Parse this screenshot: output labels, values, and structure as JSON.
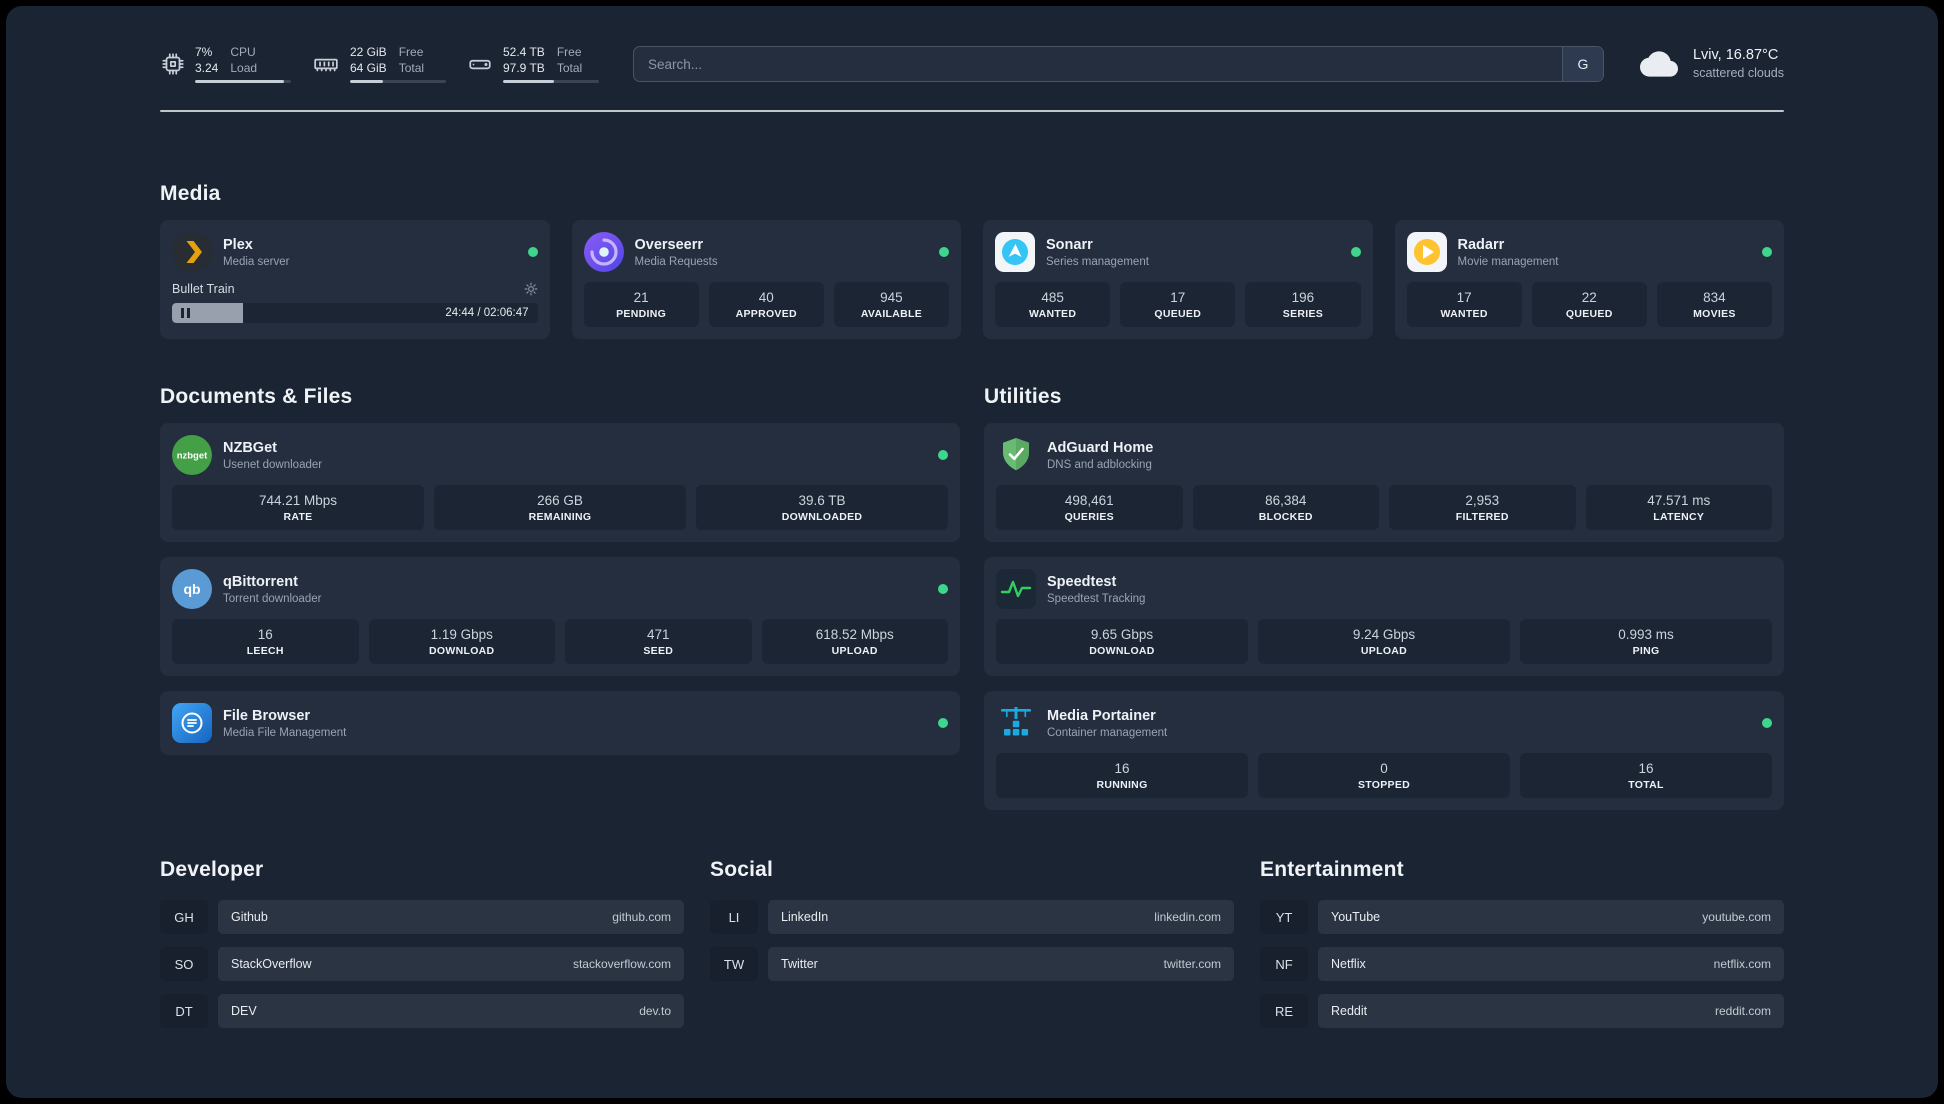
{
  "topbar": {
    "cpu": {
      "value1": "7%",
      "value2": "3.24",
      "label1": "CPU",
      "label2": "Load",
      "bar_percent": 93
    },
    "ram": {
      "value1": "22 GiB",
      "value2": "64 GiB",
      "label1": "Free",
      "label2": "Total",
      "bar_percent": 34
    },
    "disk": {
      "value1": "52.4 TB",
      "value2": "97.9 TB",
      "label1": "Free",
      "label2": "Total",
      "bar_percent": 53
    },
    "search": {
      "placeholder": "Search...",
      "button_label": "G"
    },
    "weather": {
      "location": "Lviv, 16.87°C",
      "condition": "scattered clouds"
    }
  },
  "media": {
    "title": "Media",
    "plex": {
      "name": "Plex",
      "desc": "Media server",
      "now_playing": "Bullet Train",
      "time": "24:44 / 02:06:47",
      "progress_percent": 19.4
    },
    "overseerr": {
      "name": "Overseerr",
      "desc": "Media Requests",
      "stats": [
        {
          "value": "21",
          "label": "PENDING"
        },
        {
          "value": "40",
          "label": "APPROVED"
        },
        {
          "value": "945",
          "label": "AVAILABLE"
        }
      ]
    },
    "sonarr": {
      "name": "Sonarr",
      "desc": "Series management",
      "stats": [
        {
          "value": "485",
          "label": "WANTED"
        },
        {
          "value": "17",
          "label": "QUEUED"
        },
        {
          "value": "196",
          "label": "SERIES"
        }
      ]
    },
    "radarr": {
      "name": "Radarr",
      "desc": "Movie management",
      "stats": [
        {
          "value": "17",
          "label": "WANTED"
        },
        {
          "value": "22",
          "label": "QUEUED"
        },
        {
          "value": "834",
          "label": "MOVIES"
        }
      ]
    }
  },
  "documents": {
    "title": "Documents & Files",
    "nzbget": {
      "name": "NZBGet",
      "desc": "Usenet downloader",
      "stats": [
        {
          "value": "744.21 Mbps",
          "label": "RATE"
        },
        {
          "value": "266 GB",
          "label": "REMAINING"
        },
        {
          "value": "39.6 TB",
          "label": "DOWNLOADED"
        }
      ]
    },
    "qbittorrent": {
      "name": "qBittorrent",
      "desc": "Torrent downloader",
      "stats": [
        {
          "value": "16",
          "label": "LEECH"
        },
        {
          "value": "1.19 Gbps",
          "label": "DOWNLOAD"
        },
        {
          "value": "471",
          "label": "SEED"
        },
        {
          "value": "618.52 Mbps",
          "label": "UPLOAD"
        }
      ]
    },
    "filebrowser": {
      "name": "File Browser",
      "desc": "Media File Management"
    }
  },
  "utilities": {
    "title": "Utilities",
    "adguard": {
      "name": "AdGuard Home",
      "desc": "DNS and adblocking",
      "stats": [
        {
          "value": "498,461",
          "label": "QUERIES"
        },
        {
          "value": "86,384",
          "label": "BLOCKED"
        },
        {
          "value": "2,953",
          "label": "FILTERED"
        },
        {
          "value": "47.571 ms",
          "label": "LATENCY"
        }
      ]
    },
    "speedtest": {
      "name": "Speedtest",
      "desc": "Speedtest Tracking",
      "stats": [
        {
          "value": "9.65 Gbps",
          "label": "DOWNLOAD"
        },
        {
          "value": "9.24 Gbps",
          "label": "UPLOAD"
        },
        {
          "value": "0.993 ms",
          "label": "PING"
        }
      ]
    },
    "portainer": {
      "name": "Media Portainer",
      "desc": "Container management",
      "stats": [
        {
          "value": "16",
          "label": "RUNNING"
        },
        {
          "value": "0",
          "label": "STOPPED"
        },
        {
          "value": "16",
          "label": "TOTAL"
        }
      ]
    }
  },
  "bookmarks": {
    "developer": {
      "title": "Developer",
      "items": [
        {
          "abbr": "GH",
          "name": "Github",
          "domain": "github.com"
        },
        {
          "abbr": "SO",
          "name": "StackOverflow",
          "domain": "stackoverflow.com"
        },
        {
          "abbr": "DT",
          "name": "DEV",
          "domain": "dev.to"
        }
      ]
    },
    "social": {
      "title": "Social",
      "items": [
        {
          "abbr": "LI",
          "name": "LinkedIn",
          "domain": "linkedin.com"
        },
        {
          "abbr": "TW",
          "name": "Twitter",
          "domain": "twitter.com"
        }
      ]
    },
    "entertainment": {
      "title": "Entertainment",
      "items": [
        {
          "abbr": "YT",
          "name": "YouTube",
          "domain": "youtube.com"
        },
        {
          "abbr": "NF",
          "name": "Netflix",
          "domain": "netflix.com"
        },
        {
          "abbr": "RE",
          "name": "Reddit",
          "domain": "reddit.com"
        }
      ]
    }
  },
  "colors": {
    "status_online": "#3dd68c",
    "plex_accent": "#e5a00d",
    "background": "#1b2433",
    "card": "#242e3f"
  }
}
